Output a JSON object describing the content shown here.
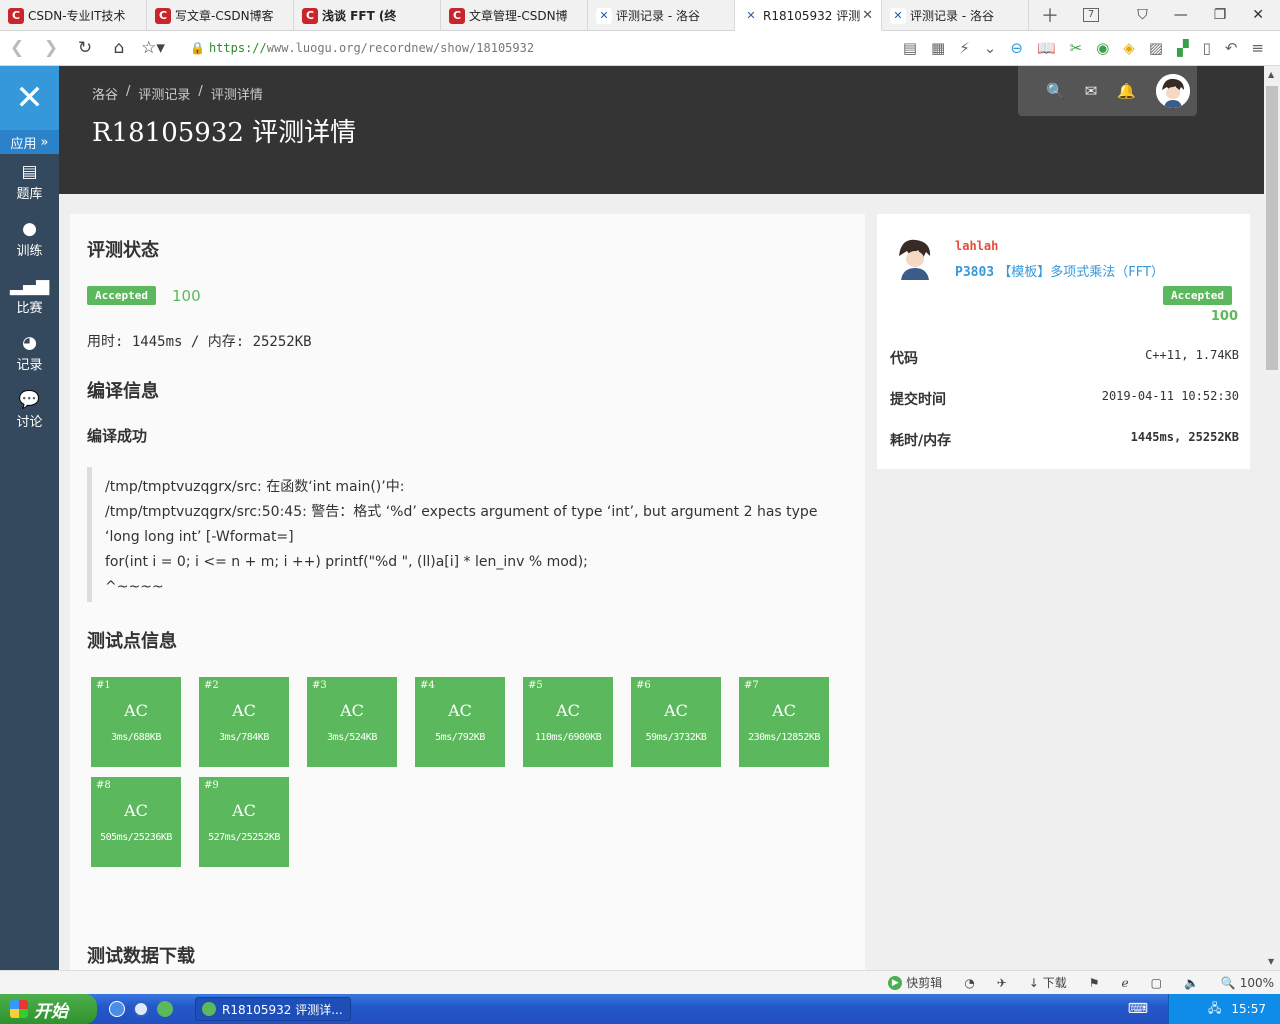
{
  "browser": {
    "tabs": [
      {
        "label": "CSDN-专业IT技术",
        "type": "csdn",
        "active": false
      },
      {
        "label": "写文章-CSDN博客",
        "type": "csdn",
        "active": false
      },
      {
        "label": "浅谈 FFT (终",
        "type": "csdn",
        "active": false
      },
      {
        "label": "文章管理-CSDN博",
        "type": "csdn",
        "active": false
      },
      {
        "label": "评测记录 - 洛谷",
        "type": "luogu",
        "active": false
      },
      {
        "label": "R18105932 评测",
        "type": "luogu",
        "active": true
      },
      {
        "label": "评测记录 - 洛谷",
        "type": "luogu",
        "active": false
      }
    ],
    "tab_count": "7",
    "url_scheme": "https://",
    "url_rest": "www.luogu.org/recordnew/show/18105932",
    "zoom": "100%",
    "status": {
      "cut": "快剪辑",
      "download": "下载"
    }
  },
  "sidebar": {
    "app_label": "应用",
    "items": [
      {
        "label": "题库",
        "icon": "book-icon"
      },
      {
        "label": "训练",
        "icon": "lightbulb-icon"
      },
      {
        "label": "比赛",
        "icon": "bar-chart-icon"
      },
      {
        "label": "记录",
        "icon": "pie-chart-icon"
      },
      {
        "label": "讨论",
        "icon": "comments-icon"
      }
    ]
  },
  "header": {
    "breadcrumb": [
      "洛谷",
      "评测记录",
      "评测详情"
    ],
    "title": "R18105932 评测详情"
  },
  "main": {
    "status_title": "评测状态",
    "status_badge": "Accepted",
    "score": "100",
    "time_mem": "用时: 1445ms / 内存: 25252KB",
    "compile_title": "编译信息",
    "compile_result": "编译成功",
    "compile_lines": [
      "/tmp/tmptvuzqgrx/src: 在函数‘int main()’中:",
      "/tmp/tmptvuzqgrx/src:50:45: 警告：格式 ‘%d’ expects argument of type ‘int’, but argument 2 has type",
      "‘long long int’ [-Wformat=]",
      "for(int i = 0; i <= n + m; i ++) printf(\"%d \", (ll)a[i] * len_inv % mod);",
      "^~~~~"
    ],
    "cases_title": "测试点信息",
    "cases": [
      {
        "num": "#1",
        "result": "AC",
        "stat": "3ms/688KB"
      },
      {
        "num": "#2",
        "result": "AC",
        "stat": "3ms/784KB"
      },
      {
        "num": "#3",
        "result": "AC",
        "stat": "3ms/524KB"
      },
      {
        "num": "#4",
        "result": "AC",
        "stat": "5ms/792KB"
      },
      {
        "num": "#5",
        "result": "AC",
        "stat": "110ms/6900KB"
      },
      {
        "num": "#6",
        "result": "AC",
        "stat": "59ms/3732KB"
      },
      {
        "num": "#7",
        "result": "AC",
        "stat": "230ms/12852KB"
      },
      {
        "num": "#8",
        "result": "AC",
        "stat": "505ms/25236KB"
      },
      {
        "num": "#9",
        "result": "AC",
        "stat": "527ms/25252KB"
      }
    ],
    "download_title": "测试数据下载"
  },
  "side": {
    "username": "lahlah",
    "problem_id": "P3803",
    "problem_name": "【模板】多项式乘法（FFT）",
    "badge": "Accepted",
    "score": "100",
    "rows": [
      {
        "k": "代码",
        "v": "C++11, 1.74KB"
      },
      {
        "k": "提交时间",
        "v": "2019-04-11 10:52:30"
      },
      {
        "k": "耗时/内存",
        "v": "1445ms, 25252KB"
      }
    ]
  },
  "taskbar": {
    "start": "开始",
    "task": "R18105932 评测详...",
    "clock": "15:57"
  },
  "colors": {
    "accepted": "#5cb85c",
    "sidebar": "#34495e",
    "logo": "#3498db",
    "header": "#343434",
    "username": "#e74c3c",
    "link": "#3498db"
  }
}
